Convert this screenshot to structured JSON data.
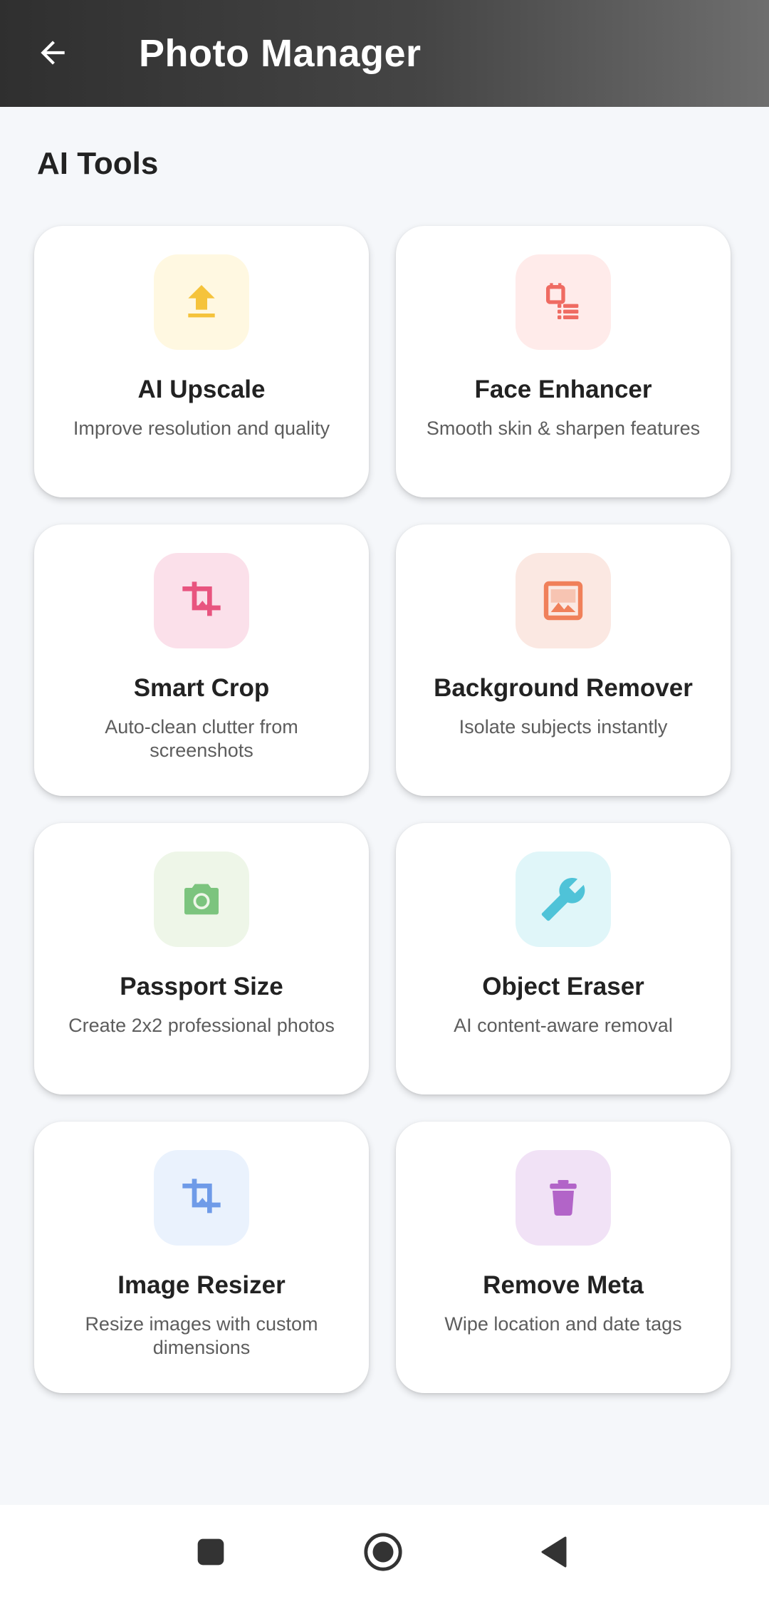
{
  "app_bar": {
    "title": "Photo Manager",
    "back_icon": "arrow-left-icon",
    "gradient": [
      "#2f2f2f",
      "#6e6e6e"
    ]
  },
  "section": {
    "title": "AI Tools"
  },
  "tools": [
    {
      "title": "AI Upscale",
      "description": "Improve resolution and quality",
      "icon": "upload-icon",
      "icon_color": "#f5c33b",
      "tile_color": "#fff8e1"
    },
    {
      "title": "Face Enhancer",
      "description": "Smooth skin & sharpen features",
      "icon": "face-enhance-icon",
      "icon_color": "#ef6b62",
      "tile_color": "#ffebea"
    },
    {
      "title": "Smart Crop",
      "description": "Auto-clean clutter from screenshots",
      "icon": "crop-icon",
      "icon_color": "#e8547f",
      "tile_color": "#fbe0ea"
    },
    {
      "title": "Background Remover",
      "description": "Isolate subjects instantly",
      "icon": "image-icon",
      "icon_color": "#f0805a",
      "tile_color": "#fbe8e2"
    },
    {
      "title": "Passport Size",
      "description": "Create 2x2 professional photos",
      "icon": "camera-icon",
      "icon_color": "#7cc47e",
      "tile_color": "#eef6e8"
    },
    {
      "title": "Object Eraser",
      "description": "AI content-aware removal",
      "icon": "wrench-icon",
      "icon_color": "#4fc3d8",
      "tile_color": "#e0f6f9"
    },
    {
      "title": "Image Resizer",
      "description": "Resize images with custom dimensions",
      "icon": "crop-icon",
      "icon_color": "#6f9be8",
      "tile_color": "#eaf2fd"
    },
    {
      "title": "Remove Meta",
      "description": "Wipe location and date tags",
      "icon": "trash-icon",
      "icon_color": "#b264c8",
      "tile_color": "#f1e2f6"
    }
  ],
  "nav": {
    "recents_icon": "square-icon",
    "home_icon": "circle-icon",
    "back_icon": "triangle-back-icon"
  }
}
